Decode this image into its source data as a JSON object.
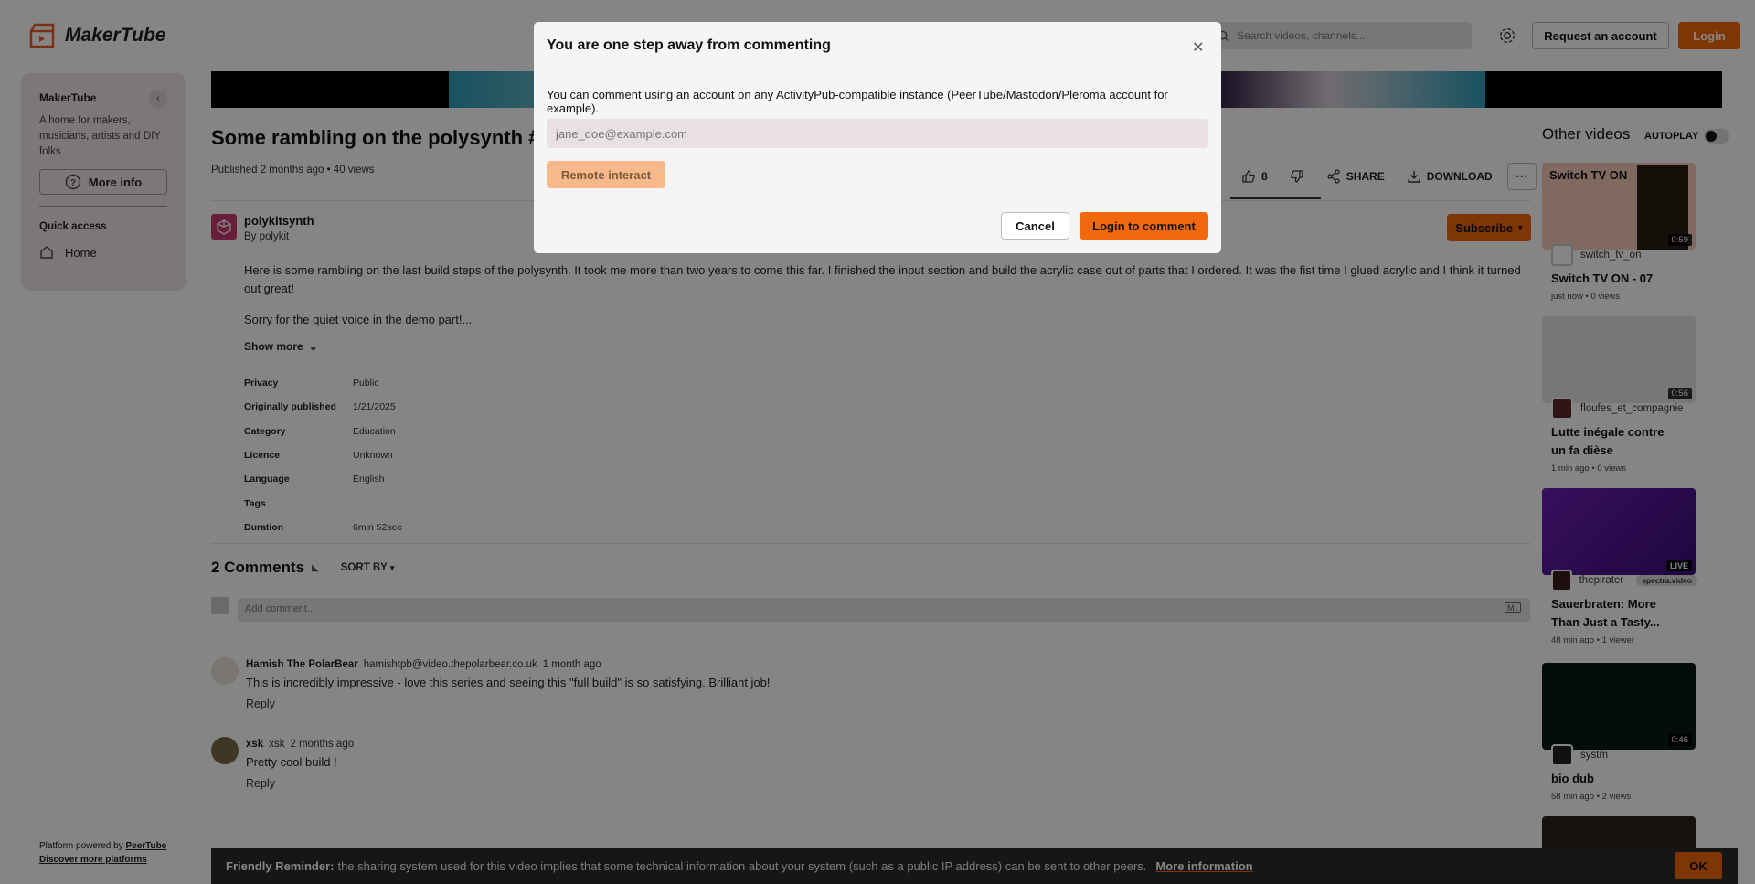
{
  "app": {
    "name": "MakerTube"
  },
  "header": {
    "search_placeholder": "Search videos, channels...",
    "request_label": "Request an account",
    "login_label": "Login"
  },
  "sidebar": {
    "title": "MakerTube",
    "description": "A home for makers, musicians, artists and DIY folks",
    "more_info": "More info",
    "quick_access": "Quick access",
    "home": "Home",
    "footer_powered": "Platform powered by",
    "footer_peertube": "PeerTube",
    "footer_discover": "Discover more platforms"
  },
  "video": {
    "title": "Some rambling on the polysynth #sy",
    "published": "Published 2 months ago • 40 views",
    "likes": "8",
    "share": "SHARE",
    "download": "DOWNLOAD",
    "channel_name": "polykitsynth",
    "channel_by": "By polykit",
    "subscribe": "Subscribe",
    "description_p1": "Here is some rambling on the last build steps of the polysynth. It took me more than two years to come this far. I finished the input section and build the acrylic case out of parts that I ordered. It was the fist time I glued acrylic and I think it turned out great!",
    "description_p2": "Sorry for the quiet voice in the demo part!...",
    "show_more": "Show more",
    "meta": [
      {
        "key": "Privacy",
        "value": "Public"
      },
      {
        "key": "Originally published",
        "value": "1/21/2025"
      },
      {
        "key": "Category",
        "value": "Education"
      },
      {
        "key": "Licence",
        "value": "Unknown"
      },
      {
        "key": "Language",
        "value": "English"
      },
      {
        "key": "Tags",
        "value": ""
      },
      {
        "key": "Duration",
        "value": "6min 52sec"
      }
    ]
  },
  "comments": {
    "count_label": "2 Comments",
    "sort_by": "SORT BY",
    "add_placeholder": "Add comment...",
    "markdown_badge": "M↓",
    "items": [
      {
        "author": "Hamish The PolarBear",
        "handle": "hamishtpb@video.thepolarbear.co.uk",
        "time": "1 month ago",
        "text": "This is incredibly impressive - love this series and seeing this \"full build\" is so satisfying. Brilliant job!",
        "reply": "Reply"
      },
      {
        "author": "xsk",
        "handle": "xsk",
        "time": "2 months ago",
        "text": "Pretty cool build !",
        "reply": "Reply"
      }
    ]
  },
  "other_videos": {
    "title": "Other videos",
    "autoplay": "AUTOPLAY",
    "items": [
      {
        "channel": "switch_tv_on",
        "title": "Switch TV ON - 07",
        "meta": "just now • 0 views",
        "duration": "0:59",
        "thumb_caption": "Switch TV ON"
      },
      {
        "channel": "floufes_et_compagnie",
        "title": "Lutte inégale contre un fa dièse",
        "meta": "1 min ago • 0 views",
        "duration": "0:56"
      },
      {
        "channel": "thepirater",
        "tag": "spectra.video",
        "title": "Sauerbraten: More Than Just a Tasty...",
        "meta": "48 min ago • 1 viewer",
        "live": "LIVE"
      },
      {
        "channel": "systm",
        "title": "bio dub",
        "meta": "58 min ago • 2 views",
        "duration": "0:46"
      }
    ]
  },
  "reminder": {
    "label": "Friendly Reminder:",
    "text": "the sharing system used for this video implies that some technical information about your system (such as a public IP address) can be sent to other peers.",
    "more": "More information",
    "ok": "OK"
  },
  "modal": {
    "title": "You are one step away from commenting",
    "text": "You can comment using an account on any ActivityPub-compatible instance (PeerTube/Mastodon/Pleroma account for example).",
    "input_placeholder": "jane_doe@example.com",
    "remote_interact": "Remote interact",
    "cancel": "Cancel",
    "login_to_comment": "Login to comment"
  },
  "colors": {
    "accent": "#f2690d"
  }
}
